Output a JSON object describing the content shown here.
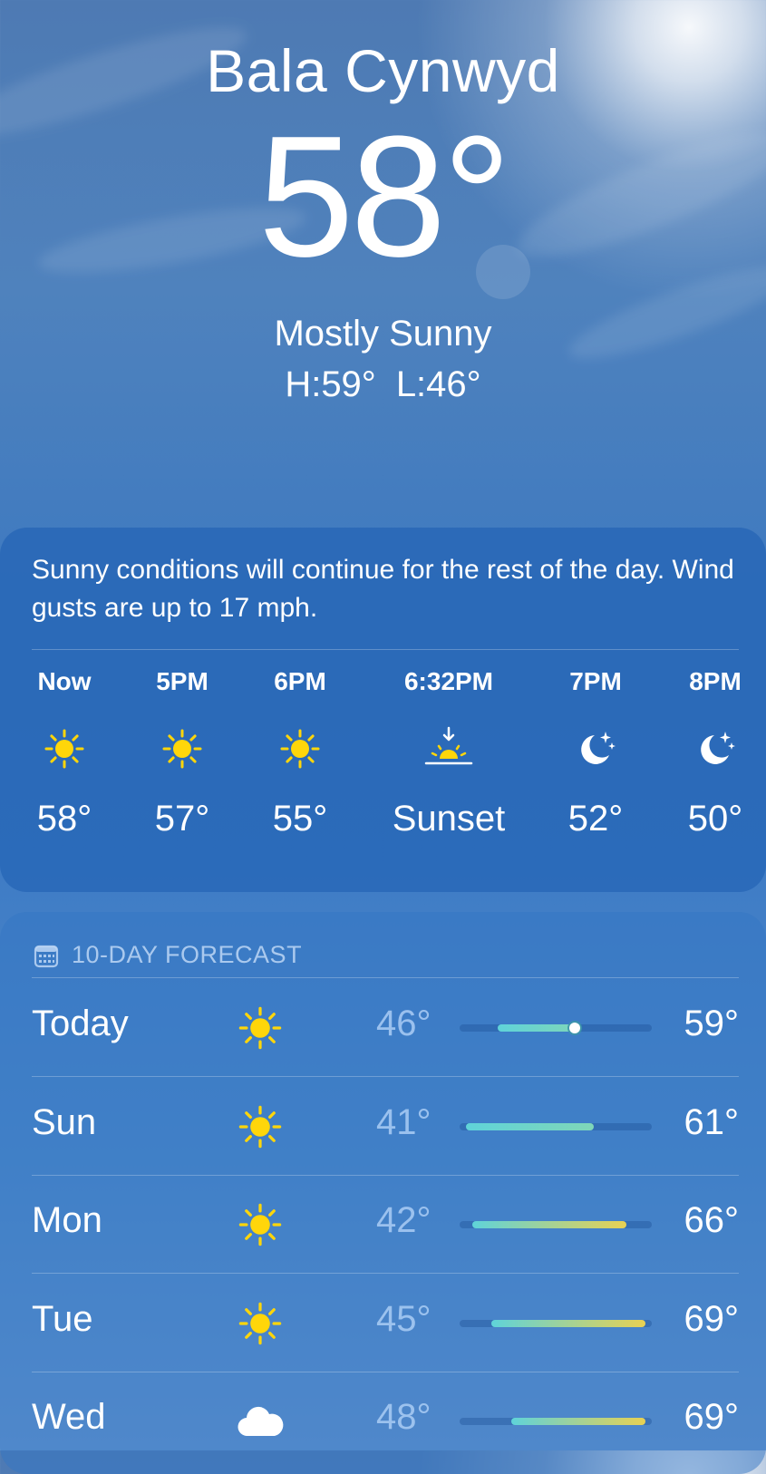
{
  "location": {
    "city": "Bala Cynwyd",
    "temperature": "58°",
    "condition": "Mostly Sunny",
    "high": "H:59°",
    "low": "L:46°"
  },
  "hourly": {
    "summary": "Sunny conditions will continue for the rest of the day. Wind gusts are up to 17 mph.",
    "items": [
      {
        "time": "Now",
        "icon": "sun-icon",
        "value": "58°"
      },
      {
        "time": "5PM",
        "icon": "sun-icon",
        "value": "57°"
      },
      {
        "time": "6PM",
        "icon": "sun-icon",
        "value": "55°"
      },
      {
        "time": "6:32PM",
        "icon": "sunset-icon",
        "value": "Sunset"
      },
      {
        "time": "7PM",
        "icon": "moon-stars-icon",
        "value": "52°"
      },
      {
        "time": "8PM",
        "icon": "moon-stars-icon",
        "value": "50°"
      }
    ]
  },
  "forecast": {
    "header": "10-DAY FORECAST",
    "days": [
      {
        "day": "Today",
        "icon": "sun-icon",
        "low": "46°",
        "high": "59°",
        "low_value": 46,
        "high_value": 59,
        "current_value": 58
      },
      {
        "day": "Sun",
        "icon": "sun-icon",
        "low": "41°",
        "high": "61°",
        "low_value": 41,
        "high_value": 61
      },
      {
        "day": "Mon",
        "icon": "sun-icon",
        "low": "42°",
        "high": "66°",
        "low_value": 42,
        "high_value": 66
      },
      {
        "day": "Tue",
        "icon": "sun-icon",
        "low": "45°",
        "high": "69°",
        "low_value": 45,
        "high_value": 69
      },
      {
        "day": "Wed",
        "icon": "cloud-icon",
        "low": "48°",
        "high": "69°",
        "low_value": 48,
        "high_value": 69
      }
    ],
    "range_min": 40,
    "range_max": 70
  },
  "colors": {
    "sun": "#FFD60A",
    "bar_cool": "#5FD3D9",
    "bar_warm": "#E8D153"
  }
}
